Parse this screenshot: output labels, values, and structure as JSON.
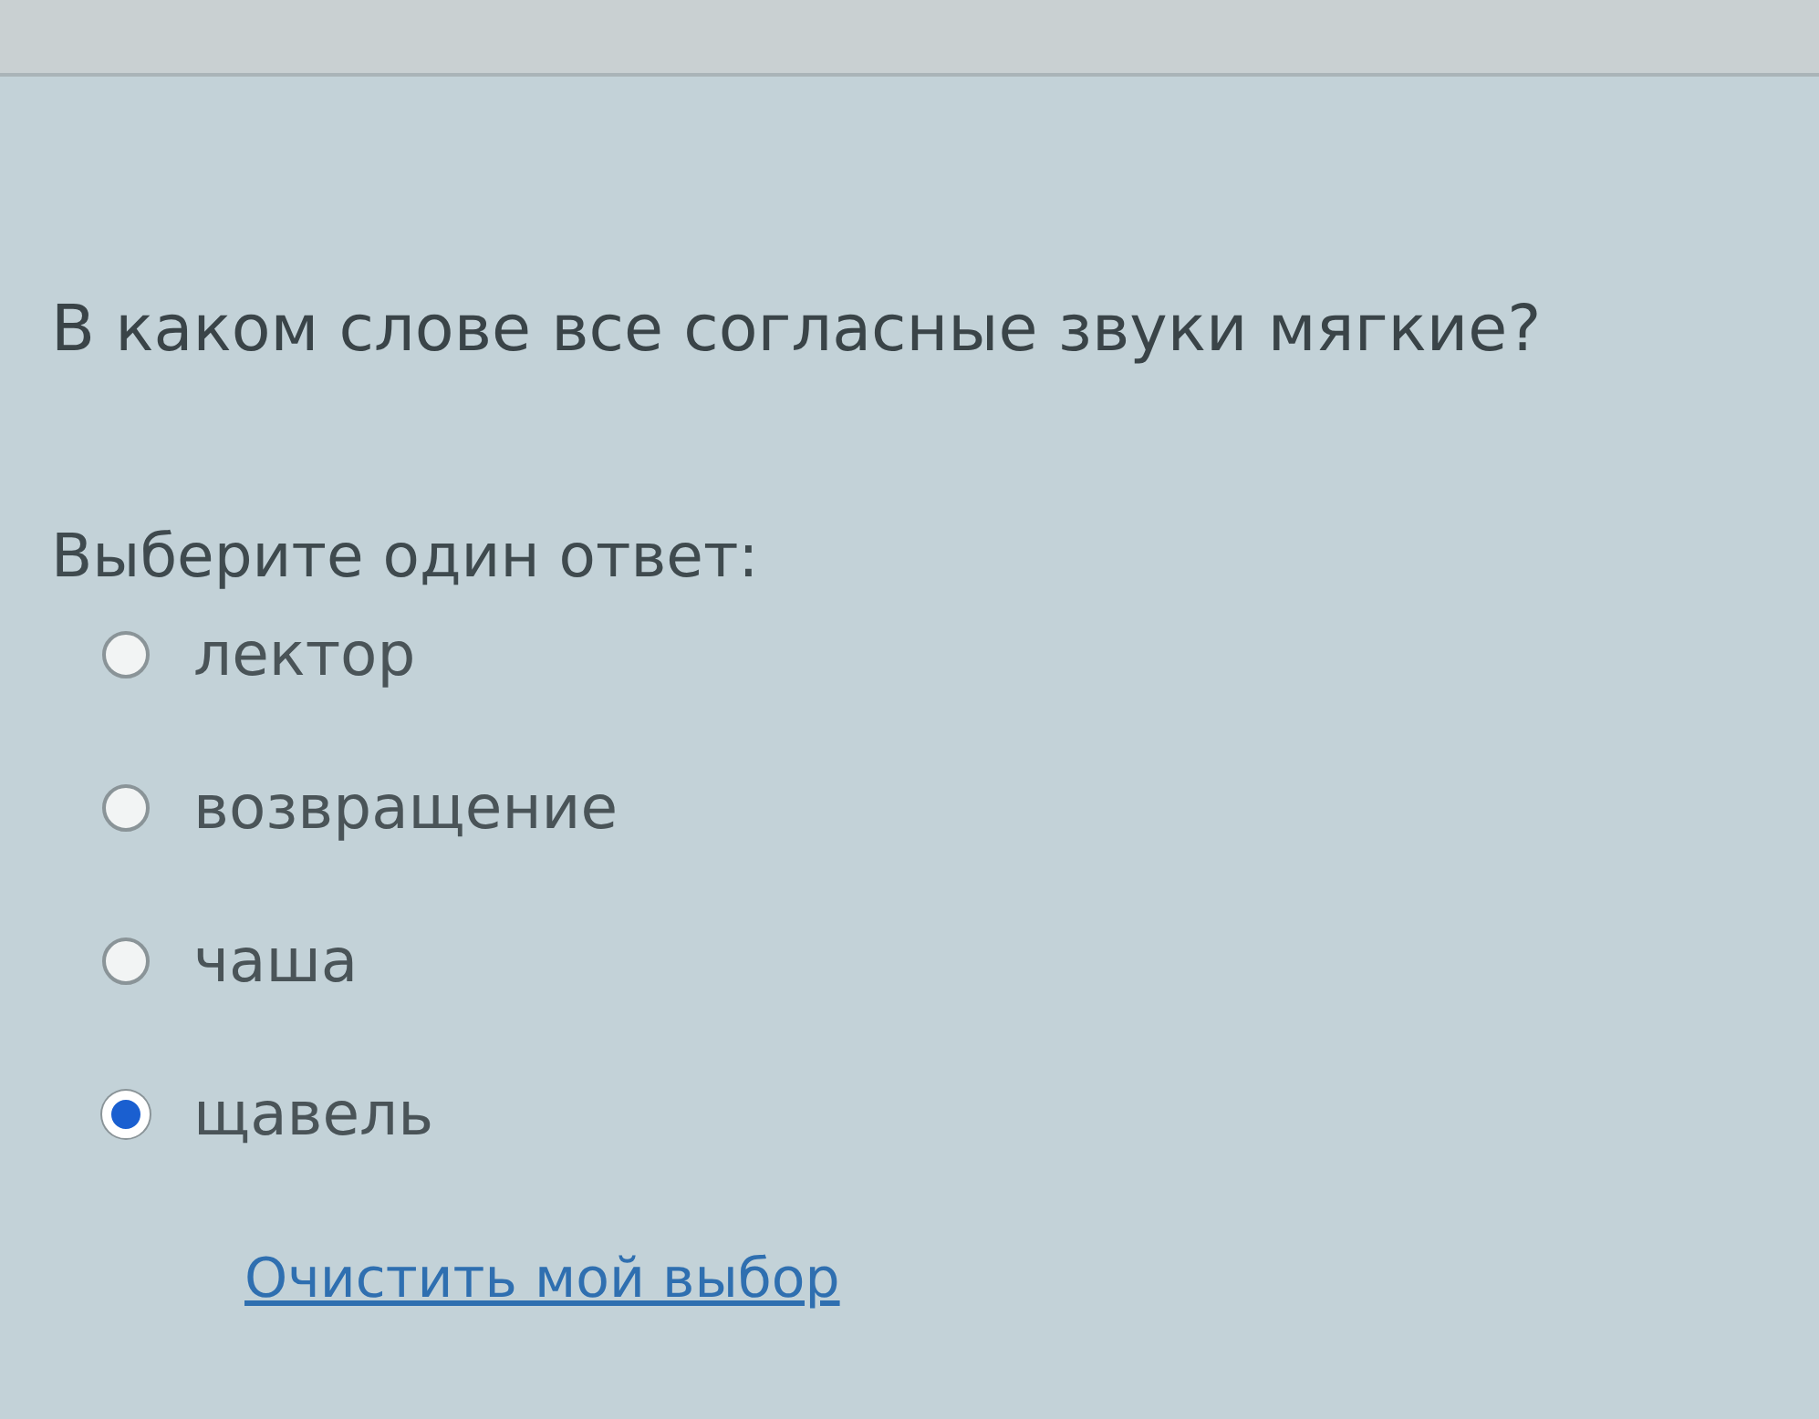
{
  "question": "В каком слове все согласные звуки мягкие?",
  "prompt": "Выберите один ответ:",
  "options": [
    {
      "label": "лектор",
      "selected": false
    },
    {
      "label": "возвращение",
      "selected": false
    },
    {
      "label": "чаша",
      "selected": false
    },
    {
      "label": "щавель",
      "selected": true
    }
  ],
  "clear_link": "Очистить мой выбор"
}
